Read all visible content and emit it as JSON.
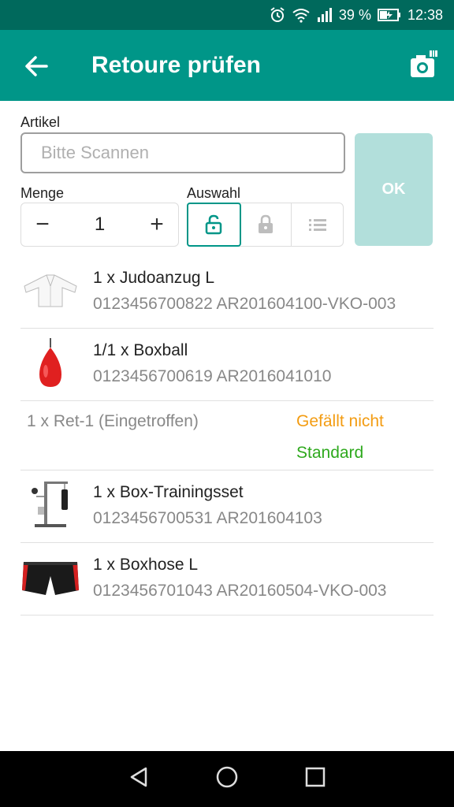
{
  "status_bar": {
    "battery": "39 %",
    "time": "12:38"
  },
  "app_bar": {
    "title": "Retoure prüfen"
  },
  "form": {
    "artikel_label": "Artikel",
    "scan_placeholder": "Bitte Scannen",
    "menge_label": "Menge",
    "quantity": "1",
    "minus": "−",
    "plus": "+",
    "auswahl_label": "Auswahl",
    "ok_label": "OK"
  },
  "items": [
    {
      "name": "1 x Judoanzug L",
      "code": "0123456700822 AR201604100-VKO-003"
    },
    {
      "name": "1/1 x Boxball",
      "code": "0123456700619 AR2016041010"
    },
    {
      "name": "1 x Box-Trainingsset",
      "code": "0123456700531 AR201604103"
    },
    {
      "name": "1 x Boxhose L",
      "code": "0123456701043 AR20160504-VKO-003"
    }
  ],
  "return_entry": {
    "text": "1 x Ret-1 (Eingetroffen)",
    "reason": "Gefällt nicht",
    "condition": "Standard"
  },
  "colors": {
    "primary": "#009688",
    "status_bar": "#00695c",
    "ok_button": "#b2dfdb",
    "reason": "#f39c12",
    "condition": "#2ea91d"
  }
}
